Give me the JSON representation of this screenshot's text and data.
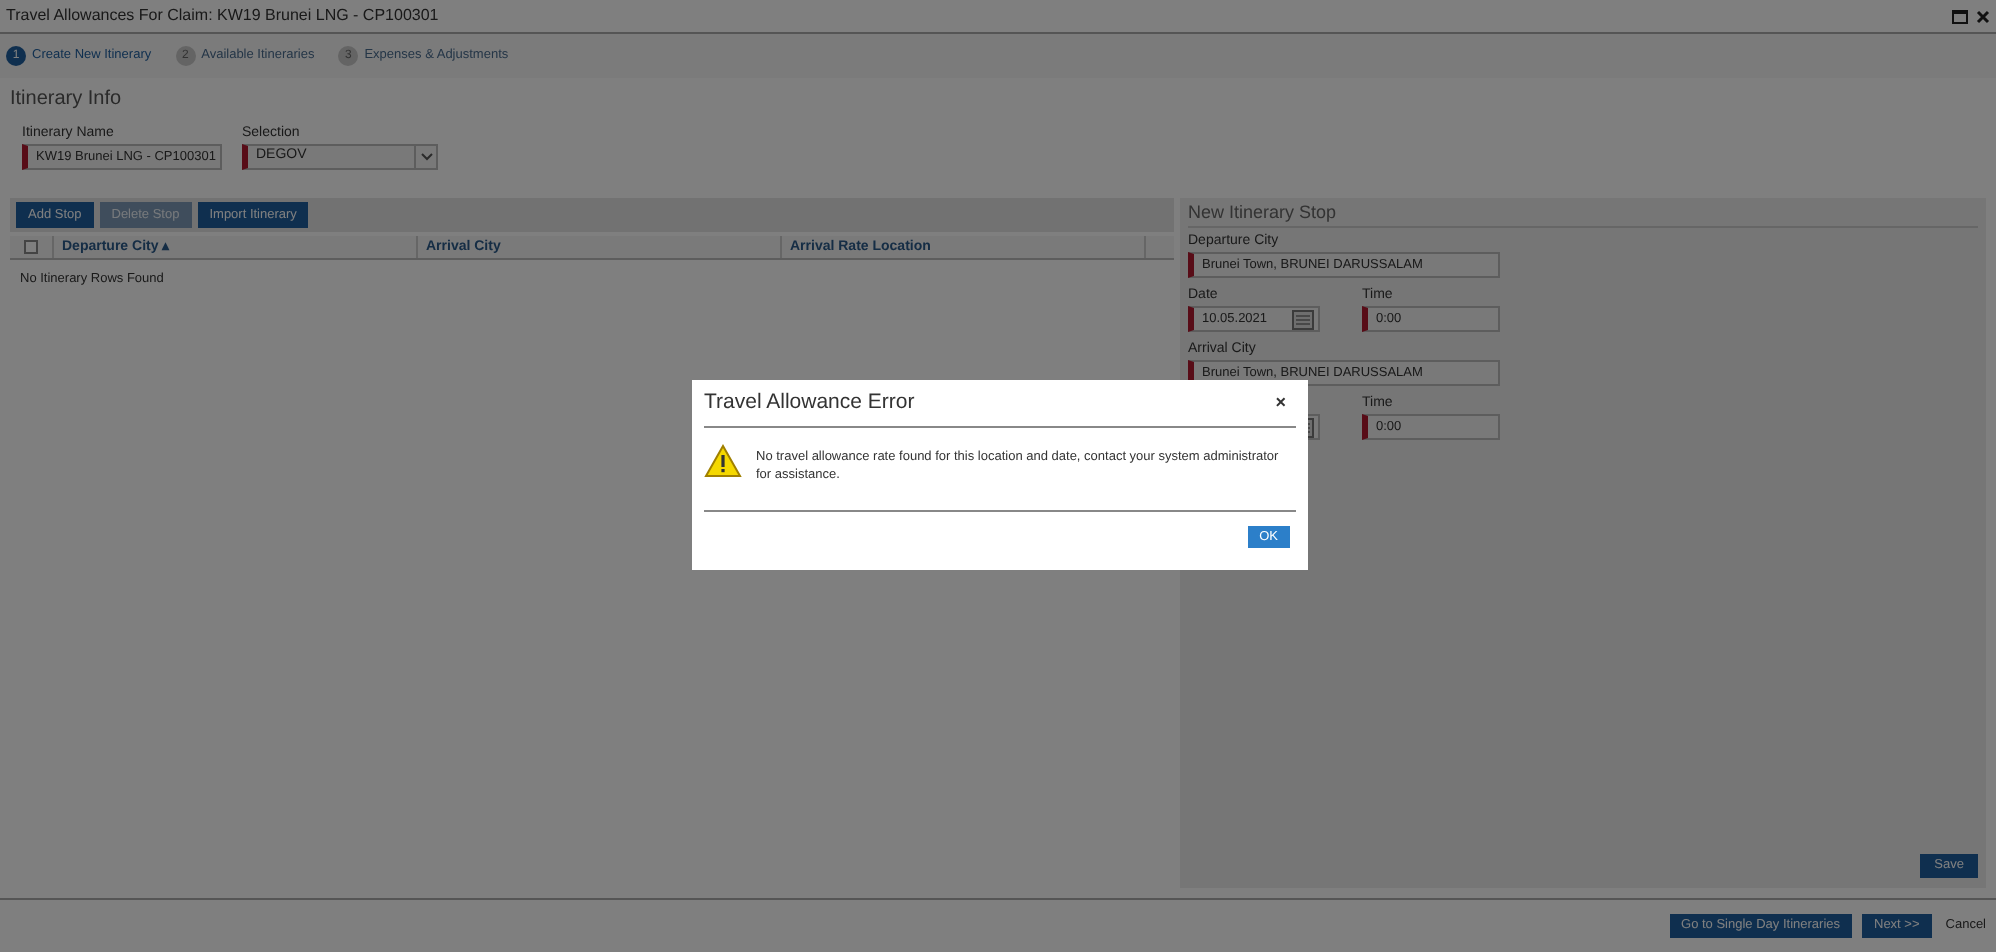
{
  "window": {
    "title": "Travel Allowances For Claim: KW19 Brunei LNG - CP100301"
  },
  "steps": [
    {
      "number": "1",
      "label": "Create New Itinerary",
      "selected": true
    },
    {
      "number": "2",
      "label": "Available Itineraries",
      "selected": false
    },
    {
      "number": "3",
      "label": "Expenses & Adjustments",
      "selected": false
    }
  ],
  "itinerary_info": {
    "title": "Itinerary Info",
    "name_label": "Itinerary Name",
    "name_value": "KW19 Brunei LNG - CP100301",
    "selection_label": "Selection",
    "selection_value": "DEGOV"
  },
  "toolbar": [
    {
      "label": "Add Stop",
      "disabled": false
    },
    {
      "label": "Delete Stop",
      "disabled": true
    },
    {
      "label": "Import Itinerary",
      "disabled": false
    }
  ],
  "table": {
    "select_all_checked": false,
    "sort_mark": "▴",
    "columns": [
      {
        "label": "Departure City",
        "sorted": true
      },
      {
        "label": "Arrival City",
        "sorted": false
      },
      {
        "label": "Arrival Rate Location",
        "sorted": false
      }
    ],
    "empty_message": "No Itinerary Rows Found"
  },
  "stop_panel": {
    "title": "New Itinerary Stop",
    "departure_city_label": "Departure City",
    "departure_city": "Brunei Town, BRUNEI DARUSSALAM",
    "departure_date_label": "Date",
    "departure_date": "10.05.2021",
    "departure_time_label": "Time",
    "departure_time": "0:00",
    "arrival_city_label": "Arrival City",
    "arrival_city": "Brunei Town, BRUNEI DARUSSALAM",
    "arrival_time_label": "Time",
    "arrival_time": "0:00",
    "save": "Save"
  },
  "footer": {
    "buttons": [
      "Go to Single Day Itineraries",
      "Next >>"
    ],
    "cancel": "Cancel"
  },
  "dialog": {
    "title": "Travel Allowance Error",
    "close": "×",
    "message": "No travel allowance rate found for this location and date, contact your system administrator for assistance.",
    "ok": "OK"
  }
}
